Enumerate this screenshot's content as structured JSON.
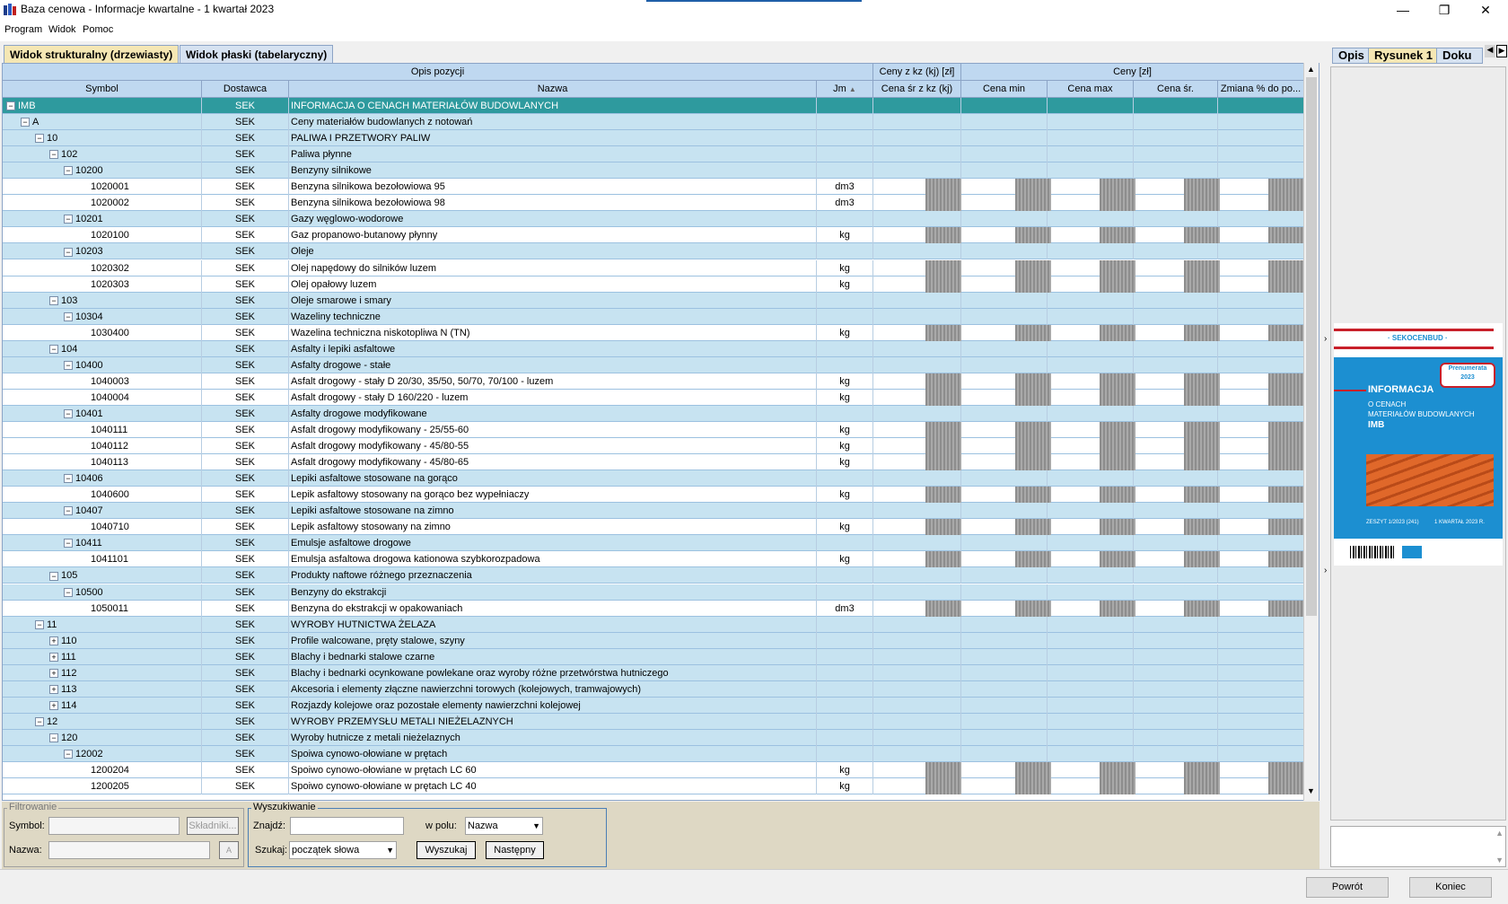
{
  "window": {
    "title": "Baza cenowa - Informacje kwartalne - 1 kwartał 2023",
    "minimize": "—",
    "restore": "❐",
    "close": "✕"
  },
  "menu": [
    "Program",
    "Widok",
    "Pomoc"
  ],
  "tabs": [
    "Widok strukturalny (drzewiasty)",
    "Widok płaski (tabelaryczny)"
  ],
  "grid": {
    "group_headers": {
      "opis": "Opis pozycji",
      "ceny_kz": "Ceny z kz (kj) [zł]",
      "ceny": "Ceny [zł]"
    },
    "columns": [
      "Symbol",
      "Dostawca",
      "Nazwa",
      "Jm",
      "Cena śr z kz (kj)",
      "Cena min",
      "Cena max",
      "Cena śr.",
      "Zmiana % do po..."
    ],
    "sort_indicator": "▲",
    "rows": [
      {
        "sym": "IMB",
        "dost": "SEK",
        "name": "INFORMACJA O CENACH MATERIAŁÓW BUDOWLANYCH",
        "jm": "",
        "lvl": 0,
        "kind": "group",
        "toggle": "−",
        "selected": true
      },
      {
        "sym": "A",
        "dost": "SEK",
        "name": "Ceny materiałów budowlanych z notowań",
        "jm": "",
        "lvl": 1,
        "kind": "group",
        "toggle": "−"
      },
      {
        "sym": "10",
        "dost": "SEK",
        "name": "PALIWA I PRZETWORY PALIW",
        "jm": "",
        "lvl": 2,
        "kind": "group",
        "toggle": "−"
      },
      {
        "sym": "102",
        "dost": "SEK",
        "name": "Paliwa płynne",
        "jm": "",
        "lvl": 3,
        "kind": "group",
        "toggle": "−"
      },
      {
        "sym": "10200",
        "dost": "SEK",
        "name": "Benzyny silnikowe",
        "jm": "",
        "lvl": 4,
        "kind": "group",
        "toggle": "−"
      },
      {
        "sym": "1020001",
        "dost": "SEK",
        "name": "Benzyna silnikowa bezołowiowa 95",
        "jm": "dm3",
        "lvl": 5,
        "kind": "leaf"
      },
      {
        "sym": "1020002",
        "dost": "SEK",
        "name": "Benzyna silnikowa bezołowiowa 98",
        "jm": "dm3",
        "lvl": 5,
        "kind": "leaf"
      },
      {
        "sym": "10201",
        "dost": "SEK",
        "name": "Gazy węglowo-wodorowe",
        "jm": "",
        "lvl": 4,
        "kind": "group",
        "toggle": "−"
      },
      {
        "sym": "1020100",
        "dost": "SEK",
        "name": "Gaz propanowo-butanowy płynny",
        "jm": "kg",
        "lvl": 5,
        "kind": "leaf"
      },
      {
        "sym": "10203",
        "dost": "SEK",
        "name": "Oleje",
        "jm": "",
        "lvl": 4,
        "kind": "group",
        "toggle": "−"
      },
      {
        "sym": "1020302",
        "dost": "SEK",
        "name": "Olej napędowy do silników luzem",
        "jm": "kg",
        "lvl": 5,
        "kind": "leaf"
      },
      {
        "sym": "1020303",
        "dost": "SEK",
        "name": "Olej opałowy luzem",
        "jm": "kg",
        "lvl": 5,
        "kind": "leaf"
      },
      {
        "sym": "103",
        "dost": "SEK",
        "name": "Oleje smarowe i smary",
        "jm": "",
        "lvl": 3,
        "kind": "group",
        "toggle": "−"
      },
      {
        "sym": "10304",
        "dost": "SEK",
        "name": "Wazeliny techniczne",
        "jm": "",
        "lvl": 4,
        "kind": "group",
        "toggle": "−"
      },
      {
        "sym": "1030400",
        "dost": "SEK",
        "name": "Wazelina techniczna niskotopliwa N (TN)",
        "jm": "kg",
        "lvl": 5,
        "kind": "leaf"
      },
      {
        "sym": "104",
        "dost": "SEK",
        "name": "Asfalty i lepiki asfaltowe",
        "jm": "",
        "lvl": 3,
        "kind": "group",
        "toggle": "−"
      },
      {
        "sym": "10400",
        "dost": "SEK",
        "name": "Asfalty drogowe - stałe",
        "jm": "",
        "lvl": 4,
        "kind": "group",
        "toggle": "−"
      },
      {
        "sym": "1040003",
        "dost": "SEK",
        "name": "Asfalt drogowy - stały D 20/30, 35/50, 50/70, 70/100 - luzem",
        "jm": "kg",
        "lvl": 5,
        "kind": "leaf"
      },
      {
        "sym": "1040004",
        "dost": "SEK",
        "name": "Asfalt drogowy - stały D 160/220 - luzem",
        "jm": "kg",
        "lvl": 5,
        "kind": "leaf"
      },
      {
        "sym": "10401",
        "dost": "SEK",
        "name": "Asfalty drogowe modyfikowane",
        "jm": "",
        "lvl": 4,
        "kind": "group",
        "toggle": "−"
      },
      {
        "sym": "1040111",
        "dost": "SEK",
        "name": "Asfalt drogowy modyfikowany - 25/55-60",
        "jm": "kg",
        "lvl": 5,
        "kind": "leaf"
      },
      {
        "sym": "1040112",
        "dost": "SEK",
        "name": "Asfalt drogowy modyfikowany - 45/80-55",
        "jm": "kg",
        "lvl": 5,
        "kind": "leaf"
      },
      {
        "sym": "1040113",
        "dost": "SEK",
        "name": "Asfalt drogowy modyfikowany - 45/80-65",
        "jm": "kg",
        "lvl": 5,
        "kind": "leaf"
      },
      {
        "sym": "10406",
        "dost": "SEK",
        "name": "Lepiki asfaltowe stosowane na gorąco",
        "jm": "",
        "lvl": 4,
        "kind": "group",
        "toggle": "−"
      },
      {
        "sym": "1040600",
        "dost": "SEK",
        "name": "Lepik asfaltowy stosowany na gorąco bez wypełniaczy",
        "jm": "kg",
        "lvl": 5,
        "kind": "leaf"
      },
      {
        "sym": "10407",
        "dost": "SEK",
        "name": "Lepiki asfaltowe stosowane na zimno",
        "jm": "",
        "lvl": 4,
        "kind": "group",
        "toggle": "−"
      },
      {
        "sym": "1040710",
        "dost": "SEK",
        "name": "Lepik asfaltowy stosowany na zimno",
        "jm": "kg",
        "lvl": 5,
        "kind": "leaf"
      },
      {
        "sym": "10411",
        "dost": "SEK",
        "name": "Emulsje asfaltowe drogowe",
        "jm": "",
        "lvl": 4,
        "kind": "group",
        "toggle": "−"
      },
      {
        "sym": "1041101",
        "dost": "SEK",
        "name": "Emulsja asfaltowa drogowa kationowa szybkorozpadowa",
        "jm": "kg",
        "lvl": 5,
        "kind": "leaf"
      },
      {
        "sym": "105",
        "dost": "SEK",
        "name": "Produkty naftowe różnego przeznaczenia",
        "jm": "",
        "lvl": 3,
        "kind": "group",
        "toggle": "−"
      },
      {
        "sym": "10500",
        "dost": "SEK",
        "name": "Benzyny do ekstrakcji",
        "jm": "",
        "lvl": 4,
        "kind": "group",
        "toggle": "−"
      },
      {
        "sym": "1050011",
        "dost": "SEK",
        "name": "Benzyna do ekstrakcji w opakowaniach",
        "jm": "dm3",
        "lvl": 5,
        "kind": "leaf"
      },
      {
        "sym": "11",
        "dost": "SEK",
        "name": "WYROBY HUTNICTWA ŻELAZA",
        "jm": "",
        "lvl": 2,
        "kind": "group",
        "toggle": "−"
      },
      {
        "sym": "110",
        "dost": "SEK",
        "name": "Profile walcowane, pręty stalowe, szyny",
        "jm": "",
        "lvl": 3,
        "kind": "group",
        "toggle": "+"
      },
      {
        "sym": "111",
        "dost": "SEK",
        "name": "Blachy i bednarki stalowe czarne",
        "jm": "",
        "lvl": 3,
        "kind": "group",
        "toggle": "+"
      },
      {
        "sym": "112",
        "dost": "SEK",
        "name": "Blachy i bednarki ocynkowane powlekane oraz wyroby różne przetwórstwa hutniczego",
        "jm": "",
        "lvl": 3,
        "kind": "group",
        "toggle": "+"
      },
      {
        "sym": "113",
        "dost": "SEK",
        "name": "Akcesoria i elementy złączne nawierzchni torowych (kolejowych, tramwajowych)",
        "jm": "",
        "lvl": 3,
        "kind": "group",
        "toggle": "+"
      },
      {
        "sym": "114",
        "dost": "SEK",
        "name": "Rozjazdy kolejowe oraz pozostałe elementy nawierzchni kolejowej",
        "jm": "",
        "lvl": 3,
        "kind": "group",
        "toggle": "+"
      },
      {
        "sym": "12",
        "dost": "SEK",
        "name": "WYROBY PRZEMYSŁU METALI NIEŻELAZNYCH",
        "jm": "",
        "lvl": 2,
        "kind": "group",
        "toggle": "−"
      },
      {
        "sym": "120",
        "dost": "SEK",
        "name": "Wyroby hutnicze z metali nieżelaznych",
        "jm": "",
        "lvl": 3,
        "kind": "group",
        "toggle": "−"
      },
      {
        "sym": "12002",
        "dost": "SEK",
        "name": "Spoiwa cynowo-ołowiane w prętach",
        "jm": "",
        "lvl": 4,
        "kind": "group",
        "toggle": "−"
      },
      {
        "sym": "1200204",
        "dost": "SEK",
        "name": "Spoiwo cynowo-ołowiane w prętach LC 60",
        "jm": "kg",
        "lvl": 5,
        "kind": "leaf"
      },
      {
        "sym": "1200205",
        "dost": "SEK",
        "name": "Spoiwo cynowo-ołowiane w prętach LC 40",
        "jm": "kg",
        "lvl": 5,
        "kind": "leaf"
      }
    ]
  },
  "filter": {
    "legend": "Filtrowanie",
    "symbol_label": "Symbol:",
    "symbol_value": "",
    "components_button": "Składniki...",
    "name_label": "Nazwa:",
    "name_value": "",
    "name_button": "A"
  },
  "search": {
    "legend": "Wyszukiwanie",
    "find_label": "Znajdź:",
    "find_value": "",
    "field_label": "w polu:",
    "field_value": "Nazwa",
    "mode_label": "Szukaj:",
    "mode_value": "początek słowa",
    "search_button": "Wyszukaj",
    "next_button": "Następny"
  },
  "right_panel": {
    "tabs": [
      "Opis",
      "Rysunek 1",
      "Doku"
    ],
    "cover": {
      "brand": "· SEKOCENBUD ·",
      "badge_line1": "Prenumerata",
      "badge_line2": "2023",
      "title1": "INFORMACJA",
      "title2": "O CENACH",
      "title3": "MATERIAŁÓW BUDOWLANYCH",
      "title4": "IMB",
      "issue": "ZESZYT 1/2023 (241)",
      "quarter": "1 KWARTAŁ 2023 R."
    }
  },
  "footer": {
    "back_button": "Powrót",
    "end_button": "Koniec"
  }
}
